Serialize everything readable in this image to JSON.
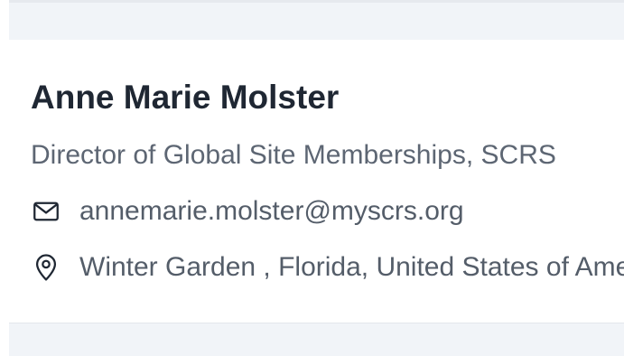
{
  "contact": {
    "name": "Anne Marie Molster",
    "title": "Director of Global Site Memberships, SCRS",
    "email": "annemarie.molster@myscrs.org",
    "location": "Winter Garden , Florida, United States of America"
  },
  "icons": {
    "email": "envelope-icon",
    "location": "map-pin-icon"
  },
  "colors": {
    "name": "#1f2733",
    "secondary_text": "#5d6673",
    "background_band": "#f1f4f8"
  }
}
